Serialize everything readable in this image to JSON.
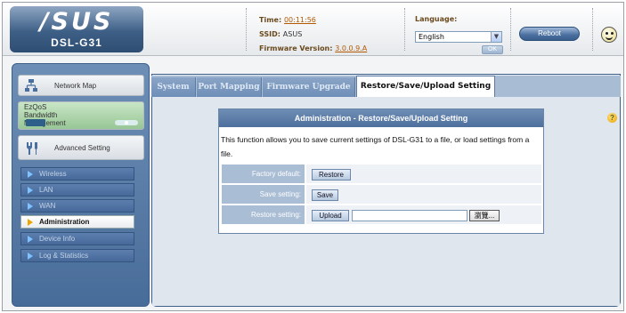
{
  "header": {
    "logo": "/SUS",
    "model": "DSL-G31",
    "time_label": "Time:",
    "time_value": "00:11:56",
    "ssid_label": "SSID:",
    "ssid_value": "ASUS",
    "firmware_label": "Firmware Version:",
    "firmware_value": "3.0.0.9.A",
    "language_label": "Language:",
    "language_value": "English",
    "ok_label": "OK",
    "reboot_label": "Reboot"
  },
  "sidebar": {
    "network_map": "Network Map",
    "ezqos": "EzQoS\nBandwidth\nManagement",
    "ezqos_lines": [
      "EzQoS",
      "Bandwidth",
      "Management"
    ],
    "advanced": "Advanced Setting",
    "items": [
      {
        "label": "Wireless"
      },
      {
        "label": "LAN"
      },
      {
        "label": "WAN"
      },
      {
        "label": "Administration",
        "active": true
      },
      {
        "label": "Device Info"
      },
      {
        "label": "Log & Statistics"
      }
    ]
  },
  "tabs": [
    {
      "label": "System"
    },
    {
      "label": "Port Mapping"
    },
    {
      "label": "Firmware Upgrade"
    },
    {
      "label": "Restore/Save/Upload Setting",
      "active": true
    }
  ],
  "panel": {
    "title": "Administration - Restore/Save/Upload Setting",
    "description": "This function allows you to save current settings of DSL-G31 to a file, or load settings from a file.",
    "rows": [
      {
        "label": "Factory default:",
        "button": "Restore"
      },
      {
        "label": "Save setting:",
        "button": "Save"
      },
      {
        "label": "Restore setting:",
        "button": "Upload",
        "browse": "瀏覽..."
      }
    ],
    "help": "?"
  }
}
